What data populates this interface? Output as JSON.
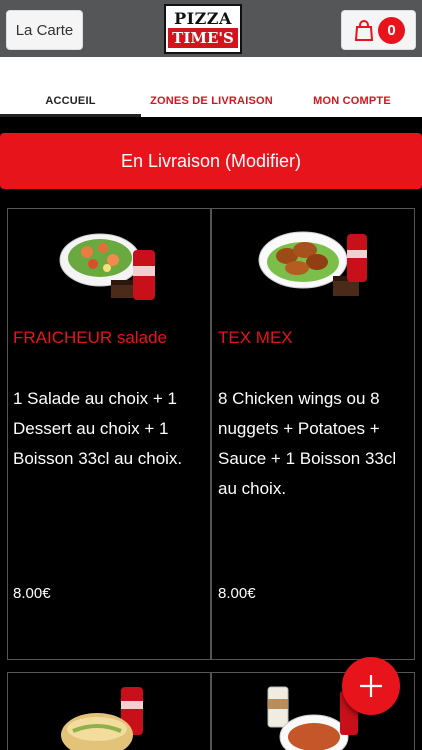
{
  "header": {
    "menu_button_label": "La Carte",
    "logo_line1": "PIZZA",
    "logo_line2": "TIME'S",
    "cart_count": "0"
  },
  "tabs": [
    {
      "label": "ACCUEIL",
      "active": true
    },
    {
      "label": "ZONES DE LIVRAISON",
      "active": false
    },
    {
      "label": "MON COMPTE",
      "active": false
    }
  ],
  "delivery_button_label": "En Livraison (Modifier)",
  "products": [
    {
      "title": "FRAICHEUR salade",
      "description": "1 Salade au choix  + 1 Dessert au choix  + 1 Boisson 33cl au choix.",
      "price": "8.00€"
    },
    {
      "title": "TEX MEX",
      "description": "8 Chicken wings ou 8 nuggets  + Potatoes  + Sauce  + 1 Boisson 33cl au choix.",
      "price": "8.00€"
    }
  ],
  "colors": {
    "accent": "#e8141c",
    "topbar": "#555657",
    "background": "#000000"
  }
}
